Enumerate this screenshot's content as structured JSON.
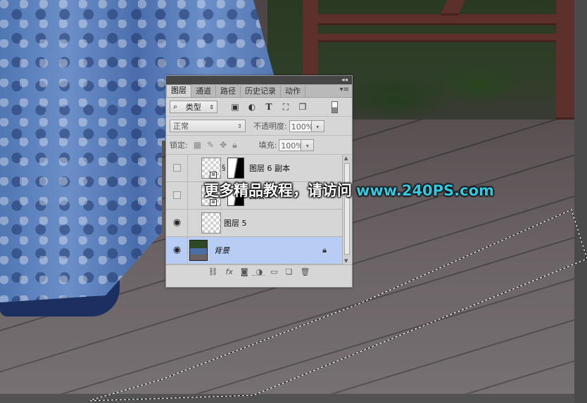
{
  "panel": {
    "tabs": [
      "图层",
      "通道",
      "路径",
      "历史记录",
      "动作"
    ],
    "active_tab": "图层",
    "filter": {
      "icon": "search-icon",
      "kind_label": "类型"
    },
    "blend_mode": "正常",
    "opacity_label": "不透明度:",
    "opacity_value": "100%",
    "lock_label": "锁定:",
    "fill_label": "填充:",
    "fill_value": "100%",
    "layers": [
      {
        "name": "图层 6 副本",
        "visible": false,
        "has_mask": true,
        "smart_object": true
      },
      {
        "name": "图层 6",
        "visible": false,
        "has_mask": true,
        "smart_object": true
      },
      {
        "name": "图层 5",
        "visible": true,
        "has_mask": false,
        "smart_object": false
      },
      {
        "name": "背景",
        "visible": true,
        "locked": true,
        "selected": true
      }
    ],
    "bottom_icons": [
      "link-icon",
      "fx-icon",
      "mask-icon",
      "adjustment-icon",
      "folder-icon",
      "new-layer-icon",
      "trash-icon"
    ],
    "bottom_fx_label": "fx"
  },
  "watermark": {
    "text": "更多精品教程，请访问",
    "url": "www.240PS.com"
  },
  "colors": {
    "selected_layer": "#b8cdf4",
    "watermark_url": "#2ecbe3"
  }
}
